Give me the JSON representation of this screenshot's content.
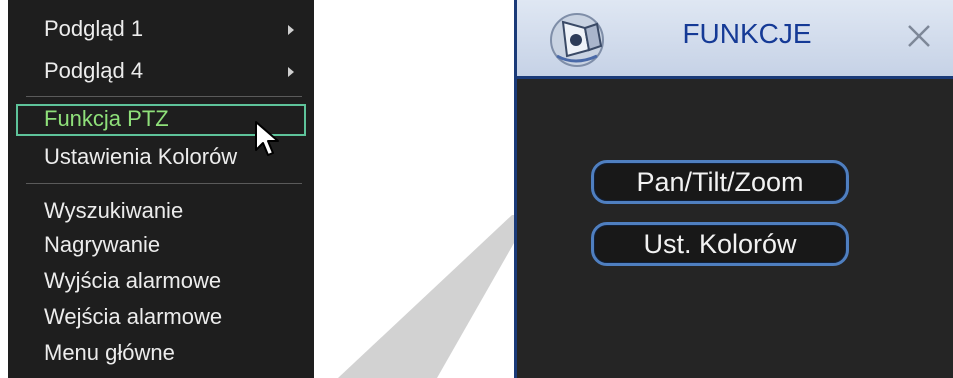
{
  "context_menu": {
    "items": [
      {
        "label": "Podgląd 1",
        "has_submenu": true
      },
      {
        "label": "Podgląd 4",
        "has_submenu": true
      },
      {
        "label": "Funkcja PTZ",
        "selected": true
      },
      {
        "label": "Ustawienia Kolorów"
      },
      {
        "label": "Wyszukiwanie"
      },
      {
        "label": "Nagrywanie"
      },
      {
        "label": "Wyjścia alarmowe"
      },
      {
        "label": "Wejścia alarmowe"
      },
      {
        "label": "Menu główne"
      }
    ],
    "selected_color": "#8fe07a",
    "highlight_border_color": "#5ec39a"
  },
  "dialog": {
    "title": "FUNKCJE",
    "buttons": [
      {
        "label": "Pan/Tilt/Zoom"
      },
      {
        "label": "Ust. Kolorów"
      }
    ],
    "accent_color": "#153a96",
    "icon": "ptz-camera-icon",
    "close_icon": "close-icon"
  }
}
